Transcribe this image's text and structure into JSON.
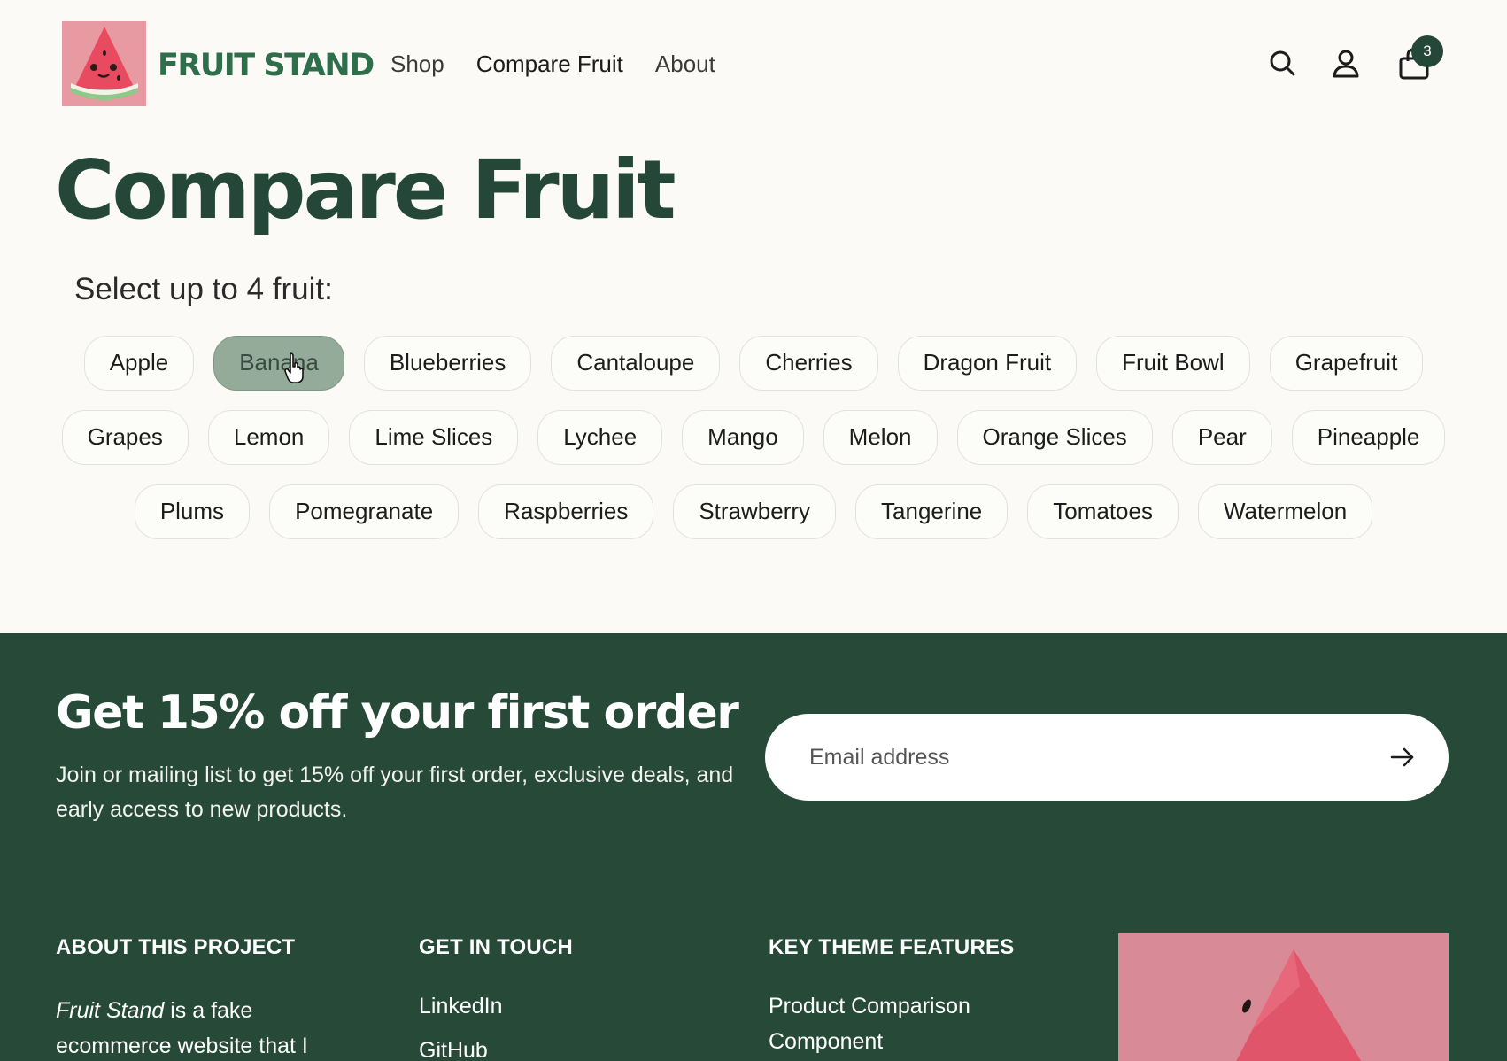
{
  "brand": {
    "name": "FRUIT STAND"
  },
  "nav": [
    {
      "label": "Shop"
    },
    {
      "label": "Compare Fruit"
    },
    {
      "label": "About"
    }
  ],
  "cart": {
    "count": "3"
  },
  "icons": [
    "search-icon",
    "account-icon",
    "cart-icon",
    "arrow-right-icon",
    "pointer-cursor-icon"
  ],
  "page": {
    "title": "Compare Fruit",
    "select_label": "Select up to 4 fruit:"
  },
  "fruit_rows": [
    [
      "Apple",
      "Banana",
      "Blueberries",
      "Cantaloupe",
      "Cherries",
      "Dragon Fruit",
      "Fruit Bowl",
      "Grapefruit"
    ],
    [
      "Grapes",
      "Lemon",
      "Lime Slices",
      "Lychee",
      "Mango",
      "Melon",
      "Orange Slices",
      "Pear",
      "Pineapple"
    ],
    [
      "Plums",
      "Pomegranate",
      "Raspberries",
      "Strawberry",
      "Tangerine",
      "Tomatoes",
      "Watermelon"
    ]
  ],
  "selected_fruit": "Banana",
  "promo": {
    "title": "Get 15% off your first order",
    "text": "Join or mailing list to get 15% off your first order, exclusive deals, and early access to new products.",
    "email_placeholder": "Email address"
  },
  "footer": {
    "about": {
      "heading": "ABOUT THIS PROJECT",
      "italic": "Fruit Stand",
      "text": " is a fake ecommerce website that I"
    },
    "contact": {
      "heading": "GET IN TOUCH",
      "links": [
        "LinkedIn",
        "GitHub"
      ]
    },
    "features": {
      "heading": "KEY THEME FEATURES",
      "links": [
        "Product Comparison Component"
      ]
    }
  },
  "colors": {
    "brand_green": "#2e6e4a",
    "dark_green": "#24473a",
    "footer_bg": "#264a37",
    "chip_selected": "#94ab9a",
    "page_bg": "#fbfaf6"
  }
}
